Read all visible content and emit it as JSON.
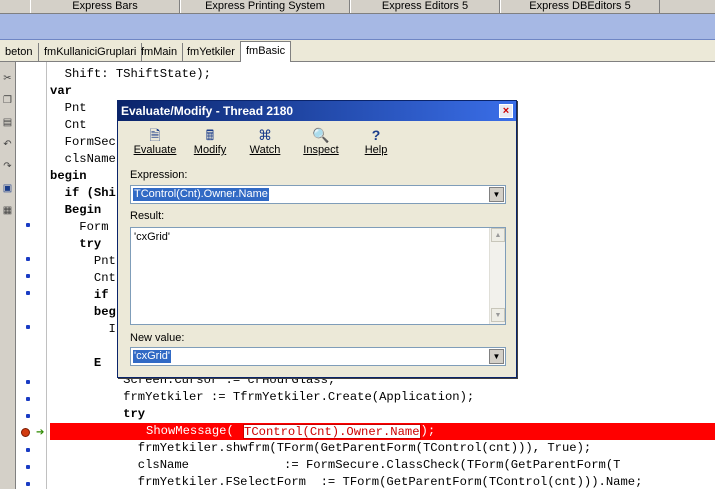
{
  "palette_tabs": [
    "Express Bars",
    "Express Printing System",
    "Express Editors 5",
    "Express DBEditors 5"
  ],
  "editor_tabs": [
    "beton",
    "fmKullaniciGruplari",
    "fmMain",
    "fmYetkiler",
    "fmBasic"
  ],
  "code_lines": [
    "  Shift: TShiftState);",
    "var",
    "  Pnt",
    "  Cnt",
    "  FormSec",
    "  clsName",
    "begin",
    "  if (Shi",
    "  Begin",
    "    Form",
    "    try",
    "      Pnt",
    "      Cnt",
    "      if",
    "      beg",
    "        I",
    "",
    "      E",
    "          Screen.Cursor := crHourGlass;",
    "          frmYetkiler := TfrmYetkiler.Create(Application);",
    "          try"
  ],
  "exec_line": {
    "prefix": "ShowMessage(",
    "highlight": "TControl(Cnt).Owner.Name",
    "suffix": ");"
  },
  "code_after": [
    "            frmYetkiler.shwfrm(TForm(GetParentForm(TControl(cnt))), True);",
    "            clsName             := FormSecure.ClassCheck(TForm(GetParentForm(T",
    "            frmYetkiler.FSelectForm  := TForm(GetParentForm(TControl(cnt))).Name;"
  ],
  "dialog": {
    "title": "Evaluate/Modify - Thread 2180",
    "close_glyph": "×",
    "toolbar": [
      {
        "label": "Evaluate",
        "icon": "evaluate-icon",
        "glyph": "🗎"
      },
      {
        "label": "Modify",
        "icon": "modify-icon",
        "glyph": "🖩"
      },
      {
        "label": "Watch",
        "icon": "watch-icon",
        "glyph": "⌘"
      },
      {
        "label": "Inspect",
        "icon": "inspect-icon",
        "glyph": "🔍"
      },
      {
        "label": "Help",
        "icon": "help-icon",
        "glyph": "?"
      }
    ],
    "expression_label": "Expression:",
    "expression_value": "TControl(Cnt).Owner.Name",
    "result_label": "Result:",
    "result_value": "'cxGrid'",
    "new_value_label": "New value:",
    "new_value": "'cxGrid'"
  }
}
